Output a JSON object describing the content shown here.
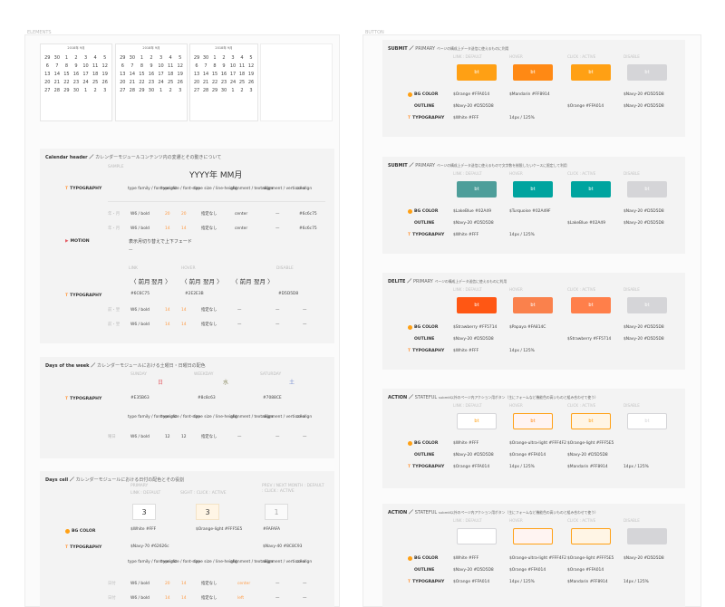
{
  "boards": {
    "elements_label": "ELEMENTS",
    "button_label": "BUTTON"
  },
  "calendars": [
    {
      "header": "2018年 9月",
      "weeks": [
        [
          "29",
          "30",
          "1",
          "2",
          "3",
          "4",
          "5"
        ],
        [
          "6",
          "7",
          "8",
          "9",
          "10",
          "11",
          "12"
        ],
        [
          "13",
          "14",
          "15",
          "16",
          "17",
          "18",
          "19"
        ],
        [
          "20",
          "21",
          "22",
          "23",
          "24",
          "25",
          "26"
        ],
        [
          "27",
          "28",
          "29",
          "30",
          "1",
          "2",
          "3"
        ]
      ]
    },
    {
      "header": "2018年 9月",
      "weeks": [
        [
          "29",
          "30",
          "1",
          "2",
          "3",
          "4",
          "5"
        ],
        [
          "6",
          "7",
          "8",
          "9",
          "10",
          "11",
          "12"
        ],
        [
          "13",
          "14",
          "15",
          "16",
          "17",
          "18",
          "19"
        ],
        [
          "20",
          "21",
          "22",
          "23",
          "24",
          "25",
          "26"
        ],
        [
          "27",
          "28",
          "29",
          "30",
          "1",
          "2",
          "3"
        ]
      ]
    },
    {
      "header": "2018年 9月",
      "weeks": [
        [
          "29",
          "30",
          "1",
          "2",
          "3",
          "4",
          "5"
        ],
        [
          "6",
          "7",
          "8",
          "9",
          "10",
          "11",
          "12"
        ],
        [
          "13",
          "14",
          "15",
          "16",
          "17",
          "18",
          "19"
        ],
        [
          "20",
          "21",
          "22",
          "23",
          "24",
          "25",
          "26"
        ],
        [
          "27",
          "28",
          "29",
          "30",
          "1",
          "2",
          "3"
        ]
      ]
    }
  ],
  "calendar_header": {
    "title": "Calendar header",
    "subtitle": "カレンダーモジュールコンテンツ内の変遷とその動きについて",
    "sample_label": "SAMPLE",
    "big_title": "YYYY年 MM月",
    "typography_label": "TYPOGRAPHY",
    "motion_label": "MOTION",
    "col_headers": [
      "type family / font-weight",
      "type size / font-size",
      "type size / line-height",
      "alignment / text-align",
      "alignment / vertical-align",
      "color"
    ],
    "rows": [
      {
        "name": "年・月",
        "weight": "W6 / bold",
        "size": "20",
        "lh": "20",
        "ls": "指定なし",
        "align": "center",
        "valign": "—",
        "color": "#6c6c75"
      },
      {
        "name": "年・月",
        "weight": "W6 / bold",
        "size": "14",
        "lh": "14",
        "ls": "指定なし",
        "align": "center",
        "valign": "—",
        "color": "#6c6c75"
      }
    ],
    "motion_text": "表示月切り替えで上下フェード",
    "motion_dash": "—",
    "nav_prev": "〈 前月",
    "nav_next": "翌月 〉",
    "nav_state_labels": [
      "LINK",
      "HOVER",
      "DISABLE"
    ],
    "nav_colors": [
      "#6C6C75",
      "#2E2E3B",
      "#D5D5D8"
    ],
    "nav_rows": [
      {
        "name": "前・翌",
        "weight": "W6 / bold",
        "size": "14",
        "lh": "14",
        "ls": "指定なし",
        "align": "—",
        "valign": "—",
        "color": "—"
      },
      {
        "name": "前・翌",
        "weight": "W6 / bold",
        "size": "14",
        "lh": "14",
        "ls": "指定なし",
        "align": "—",
        "valign": "—",
        "color": "—"
      }
    ]
  },
  "days_of_week": {
    "title": "Days of the week",
    "subtitle": "カレンダーモジュールにおける土曜日・日曜日の配色",
    "labels": [
      "SUNDAY",
      "WEEKDAY",
      "SATURDAY"
    ],
    "chars": [
      "日",
      "水",
      "土"
    ],
    "colors": [
      "#E35B63",
      "#8c8c63",
      "#7088CE"
    ],
    "typography_label": "TYPOGRAPHY",
    "col_headers": [
      "type family / font-weight",
      "type size / font-size",
      "type size / line-height",
      "alignment / text-align",
      "alignment / vertical-align",
      "color"
    ],
    "row": {
      "name": "曜日",
      "weight": "W6 / bold",
      "size": "12",
      "lh": "12",
      "ls": "指定なし",
      "align": "—",
      "valign": "—",
      "color": "—"
    }
  },
  "days_cell": {
    "title": "Days cell",
    "subtitle": "カレンダーモジュールにおける日付の配色とその役割",
    "state_labels": [
      "PRIMARY",
      "LINK : DEFAULT",
      "SIGHT : CLICK : ACTIVE",
      "PREV / NEXT MONTH : DEFAULT : CLICK : ACTIVE"
    ],
    "values": [
      "3",
      "3",
      "1"
    ],
    "bg_label": "BG COLOR",
    "bg_colors": [
      "$White #FFF",
      "$Orange-light #FFF5E5",
      "#FAFAFA"
    ],
    "typo_label": "TYPOGRAPHY",
    "typo_colors": [
      "$Navy-70 #62626c",
      "$Navy-40 #8C8C93"
    ],
    "col_headers": [
      "type family / font-weight",
      "type size / font-size",
      "type size / line-height",
      "alignment / text-align",
      "alignment / vertical-align",
      "color"
    ],
    "rows": [
      {
        "name": "日付",
        "weight": "W6 / bold",
        "size": "20",
        "lh": "14",
        "ls": "指定なし",
        "align": "center",
        "valign": "—",
        "color": "—"
      },
      {
        "name": "日付",
        "weight": "W6 / bold",
        "size": "14",
        "lh": "14",
        "ls": "指定なし",
        "align": "left",
        "valign": "—",
        "color": "—"
      }
    ]
  },
  "buttons": [
    {
      "title": "SUBMIT",
      "kind": "PRIMARY",
      "desc": "ページの構成上データ送信に使えるものに利用",
      "states": [
        "LINK : DEFAULT",
        "HOVER",
        "CLICK : ACTIVE",
        "DISABLE"
      ],
      "btn_text": "bt",
      "fills": [
        "#FFA014",
        "#FF8914",
        "#FFA014",
        "#D5D5D8"
      ],
      "borders": [
        "#FFA014",
        "#FF8914",
        "#FFA014",
        "#D5D5D8"
      ],
      "text_colors": [
        "#FFFFFF",
        "#FFFFFF",
        "#FFFFFF",
        "#FFFFFF"
      ],
      "bg_label": "BG COLOR",
      "outline_label": "OUTLINE",
      "typo_label": "TYPOGRAPHY",
      "bg": [
        "$Orange #FFA014",
        "$Mandarin #FF8914",
        "",
        "$Navy-20 #D5D5D8"
      ],
      "outline": [
        "$Navy-20 #D5D5D8",
        "",
        "$Orange #FFA014",
        "$Navy-20 #D5D5D8"
      ],
      "typo": [
        "$White #FFF",
        "14px / 125%",
        "",
        ""
      ],
      "dot": "#FFA014"
    },
    {
      "title": "SUBMIT",
      "kind": "PRIMARY",
      "desc": "ページの構成上データ送信に使えるもので文字数を制限したいケースに限定して利用",
      "states": [
        "LINK : DEFAULT",
        "HOVER",
        "CLICK : ACTIVE",
        "DISABLE"
      ],
      "btn_text": "bt",
      "fills": [
        "#4E9E9A",
        "#00A49F",
        "#00A49F",
        "#D5D5D8"
      ],
      "borders": [
        "#4E9E9A",
        "#00A49F",
        "#00A49F",
        "#D5D5D8"
      ],
      "text_colors": [
        "#FFFFFF",
        "#FFFFFF",
        "#FFFFFF",
        "#FFFFFF"
      ],
      "bg_label": "BG COLOR",
      "outline_label": "OUTLINE",
      "typo_label": "TYPOGRAPHY",
      "bg": [
        "$LakeBlue #02A49",
        "$Turquoise #02A49F",
        "",
        "$Navy-20 #D5D5D8"
      ],
      "outline": [
        "$Navy-20 #D5D5D8",
        "",
        "$LakeBlue #02A49",
        "$Navy-20 #D5D5D8"
      ],
      "typo": [
        "$White #FFF",
        "14px / 125%",
        "",
        ""
      ],
      "dot": "#FFA014"
    },
    {
      "title": "DELITE",
      "kind": "PRIMARY",
      "desc": "ページの構成上データ送信に使えるものに利用",
      "states": [
        "LINK : DEFAULT",
        "HOVER",
        "CLICK : ACTIVE",
        "DISABLE"
      ],
      "btn_text": "bt",
      "fills": [
        "#FF5714",
        "#FA814C",
        "#FF7F4A",
        "#D5D5D8"
      ],
      "borders": [
        "#FF5714",
        "#FA814C",
        "#FF7F4A",
        "#D5D5D8"
      ],
      "text_colors": [
        "#FFFFFF",
        "#FFFFFF",
        "#FFFFFF",
        "#FFFFFF"
      ],
      "bg_label": "BG COLOR",
      "outline_label": "OUTLINE",
      "typo_label": "TYPOGRAPHY",
      "bg": [
        "$Strawberry #FF5714",
        "$Papaya #FA814C",
        "",
        "$Navy-20 #D5D5D8"
      ],
      "outline": [
        "$Navy-20 #D5D5D8",
        "",
        "$Strawberry #FF5714",
        "$Navy-20 #D5D5D8"
      ],
      "typo": [
        "$White #FFF",
        "14px / 125%",
        "",
        ""
      ],
      "dot": "#FFA014"
    },
    {
      "title": "ACTION",
      "kind": "STATEFUL",
      "desc": "submit以外のページ内アクション用ボタン（主にフォームなど機能色の高いものと組み合わせて使う）",
      "states": [
        "LINK : DEFAULT",
        "HOVER",
        "CLICK : ACTIVE",
        "DISABLE"
      ],
      "btn_text": "bt",
      "fills": [
        "#FFFFFF",
        "#FFF4F2",
        "#FFF5E5",
        "#FFFFFF"
      ],
      "borders": [
        "#D5D5D8",
        "#FFA014",
        "#FFA014",
        "#D5D5D8"
      ],
      "text_colors": [
        "#FFA014",
        "#FF8914",
        "#FFA014",
        "#D5D5D8"
      ],
      "bg_label": "BG COLOR",
      "outline_label": "OUTLINE",
      "typo_label": "TYPOGRAPHY",
      "bg": [
        "$White #FFF",
        "$Orange-ultra-light #FFF4F2",
        "$Orange-light #FFF5E5",
        ""
      ],
      "outline": [
        "$Navy-20 #D5D5D8",
        "$Orange #FFA014",
        "$Navy-20 #D5D5D8",
        ""
      ],
      "typo": [
        "$Orange #FFA014",
        "14px / 125%",
        "$Mandarin #FF8914",
        "14px / 125%"
      ],
      "dot": "#FFA014"
    },
    {
      "title": "ACTION",
      "kind": "STATEFUL",
      "desc": "submit以外のページ内アクション用ボタン（主にフォームなど機能色の高いものと組み合わせて使う）",
      "states": [
        "LINK : DEFAULT",
        "HOVER",
        "CLICK : ACTIVE",
        "DISABLE"
      ],
      "btn_text": "",
      "fills": [
        "#FFFFFF",
        "#FFF4F2",
        "#FFF5E5",
        "#D5D5D8"
      ],
      "borders": [
        "#D5D5D8",
        "#FFA014",
        "#FFA014",
        "#D5D5D8"
      ],
      "text_colors": [
        "#FFA014",
        "#FF8914",
        "#FFA014",
        "#FFFFFF"
      ],
      "bg_label": "BG COLOR",
      "outline_label": "OUTLINE",
      "typo_label": "TYPOGRAPHY",
      "bg": [
        "$White #FFF",
        "$Orange-ultra-light #FFF4F2",
        "$Orange-light #FFF5E5",
        "$Navy-20 #D5D5D8"
      ],
      "outline": [
        "$Navy-20 #D5D5D8",
        "$Orange #FFA014",
        "$Orange #FFA014",
        ""
      ],
      "typo": [
        "$Orange #FFA014",
        "14px / 125%",
        "$Mandarin #FF8914",
        "14px / 125%"
      ],
      "dot": "#FFA014"
    }
  ]
}
